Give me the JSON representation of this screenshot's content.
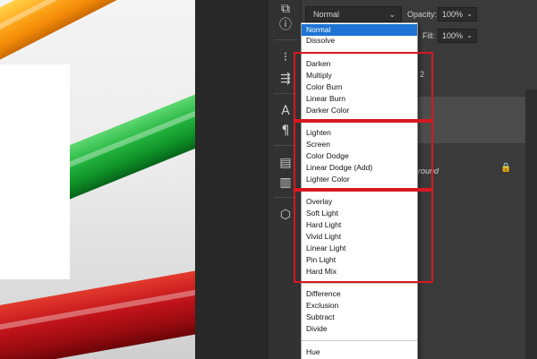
{
  "canvas": {
    "description_icons": [
      "orange-pencil",
      "green-pencil",
      "red-pencil"
    ]
  },
  "tools": [
    "3d-panel-icon",
    "info-icon",
    "adjustments-icon",
    "path-icon",
    "character-text-icon",
    "paragraph-icon",
    "properties-icon",
    "notes-icon",
    "cube-icon"
  ],
  "layers_panel": {
    "blend_mode": "Normal",
    "opacity_label": "Opacity:",
    "opacity_value": "100%",
    "fill_label": "Fill:",
    "fill_value": "100%",
    "background_layer_name": "round",
    "layer_tag": "2"
  },
  "blend_menu": {
    "groups": [
      [
        "Normal",
        "Dissolve"
      ],
      [
        "Darken",
        "Multiply",
        "Color Burn",
        "Linear Burn",
        "Darker Color"
      ],
      [
        "Lighten",
        "Screen",
        "Color Dodge",
        "Linear Dodge (Add)",
        "Lighter Color"
      ],
      [
        "Overlay",
        "Soft Light",
        "Hard Light",
        "Vivid Light",
        "Linear Light",
        "Pin Light",
        "Hard Mix"
      ],
      [
        "Difference",
        "Exclusion",
        "Subtract",
        "Divide"
      ],
      [
        "Hue"
      ]
    ],
    "selected": "Normal",
    "highlight_color": "#d7181f",
    "selection_color": "#1e74d4"
  }
}
